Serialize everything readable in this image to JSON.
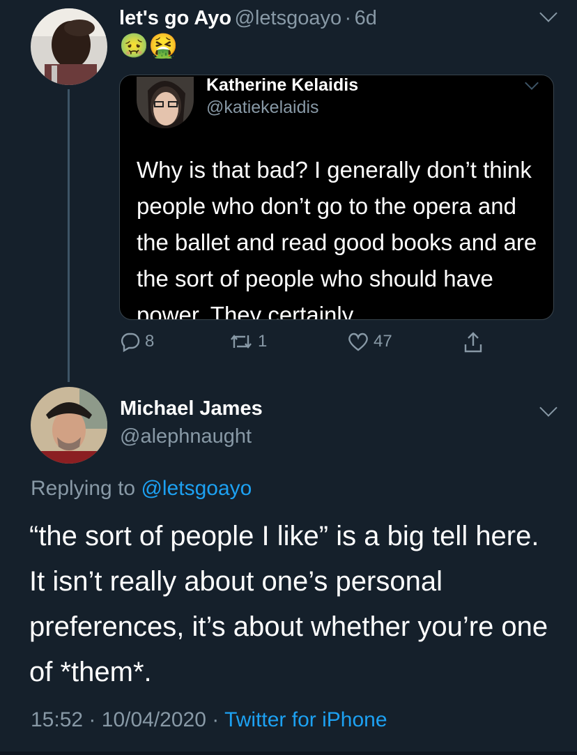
{
  "tweet": {
    "author_name": "let's go Ayo",
    "author_handle": "@letsgoayo",
    "time_sep": "·",
    "time": "6d",
    "emoji": "🤢🤮"
  },
  "quoted": {
    "author_name": "Katherine Kelaidis",
    "author_handle": "@katiekelaidis",
    "text": "Why is that bad? I generally don’t think people who don’t go to the opera and the ballet and read good books and are the sort of people who should have power. They certainly"
  },
  "actions": {
    "replies": "8",
    "retweets": "1",
    "likes": "47"
  },
  "reply": {
    "author_name": "Michael James",
    "author_handle": "@alephnaught",
    "replying_label": "Replying to",
    "replying_handle": "@letsgoayo",
    "text": "“the sort of people I like” is a big tell here. It isn’t really about one’s personal preferences, it’s about whether you’re one of *them*.",
    "time": "15:52",
    "date": "10/04/2020",
    "sep": "·",
    "source": "Twitter for iPhone"
  },
  "colors": {
    "background": "#15202b",
    "link": "#1da1f2",
    "secondary": "#8899a6"
  }
}
